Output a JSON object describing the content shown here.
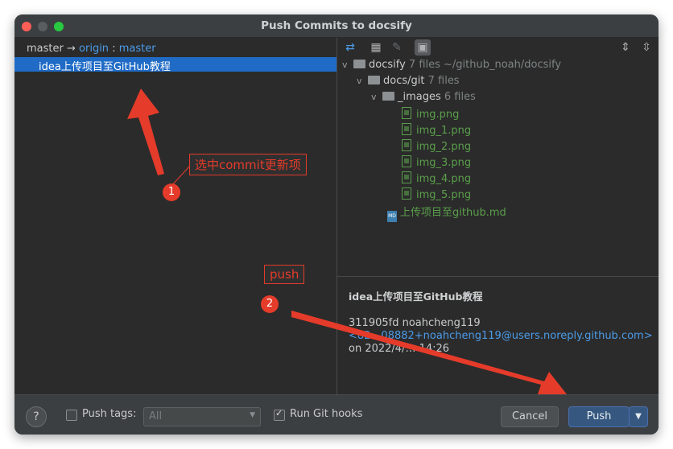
{
  "window": {
    "title": "Push Commits to docsify"
  },
  "left_panel": {
    "branch_local": "master",
    "branch_arrow": "→",
    "branch_remote": "origin",
    "branch_sep": ":",
    "branch_remote_branch": "master",
    "commits": [
      "idea上传项目至GitHub教程"
    ]
  },
  "toolbar": {
    "icons": [
      "pin-icon",
      "group-icon",
      "edit-icon",
      "preview-icon",
      "expand-all-icon",
      "collapse-all-icon"
    ]
  },
  "tree": {
    "root": {
      "name": "docsify",
      "meta": "7 files ~/github_noah/docsify"
    },
    "sub": {
      "name": "docs/git",
      "meta": "7 files"
    },
    "images_dir": {
      "name": "_images",
      "meta": "6 files"
    },
    "image_files": [
      "img.png",
      "img_1.png",
      "img_2.png",
      "img_3.png",
      "img_4.png",
      "img_5.png"
    ],
    "md_file": "上传项目至github.md"
  },
  "details": {
    "message": "idea上传项目至GitHub教程",
    "hash_author": "311905fd noahcheng119",
    "email": "<82…08882+noahcheng119@users.noreply.github.com>",
    "date": "on 2022/4/… 14:26"
  },
  "bottom": {
    "help": "?",
    "push_tags_label": "Push tags:",
    "push_tags_value": "All",
    "run_hooks_label": "Run Git hooks",
    "run_hooks_checked": true,
    "cancel": "Cancel",
    "push": "Push",
    "dropdown": "▼"
  },
  "annotations": {
    "label1": "选中commit更新项",
    "num1": "1",
    "label2": "push",
    "num2": "2",
    "color": "#e53b2a"
  }
}
